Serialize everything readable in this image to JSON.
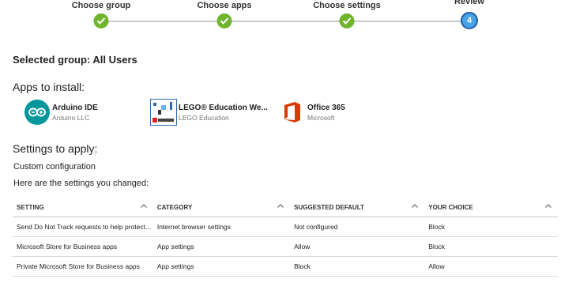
{
  "wizard": {
    "steps": [
      {
        "label": "Choose group",
        "state": "done"
      },
      {
        "label": "Choose apps",
        "state": "done"
      },
      {
        "label": "Choose settings",
        "state": "done"
      },
      {
        "label": "Review",
        "state": "current",
        "number": "4"
      }
    ]
  },
  "selected_group": "Selected group: All Users",
  "apps_section": {
    "title": "Apps to install:",
    "apps": [
      {
        "name": "Arduino IDE",
        "publisher": "Arduino LLC",
        "icon": "arduino-icon"
      },
      {
        "name": "LEGO® Education We...",
        "publisher": "LEGO Education",
        "icon": "lego-education-icon"
      },
      {
        "name": "Office 365",
        "publisher": "Microsoft",
        "icon": "office-icon"
      }
    ]
  },
  "settings_section": {
    "title": "Settings to apply:",
    "configuration": "Custom configuration",
    "intro": "Here are the settings you changed:"
  },
  "table": {
    "headers": [
      "SETTING",
      "CATEGORY",
      "SUGGESTED DEFAULT",
      "YOUR CHOICE"
    ],
    "rows": [
      [
        "Send Do Not Track requests to help protect...",
        "Internet browser settings",
        "Not configured",
        "Block"
      ],
      [
        "Microsoft Store for Business apps",
        "App settings",
        "Allow",
        "Block"
      ],
      [
        "Private Microsoft Store for Business apps",
        "App settings",
        "Block",
        "Allow"
      ]
    ]
  },
  "colors": {
    "done": "#6fb52c",
    "current": "#4aa3e8",
    "current_border": "#1f5ea8",
    "office_orange": "#d83b01",
    "arduino_teal": "#00979c"
  }
}
